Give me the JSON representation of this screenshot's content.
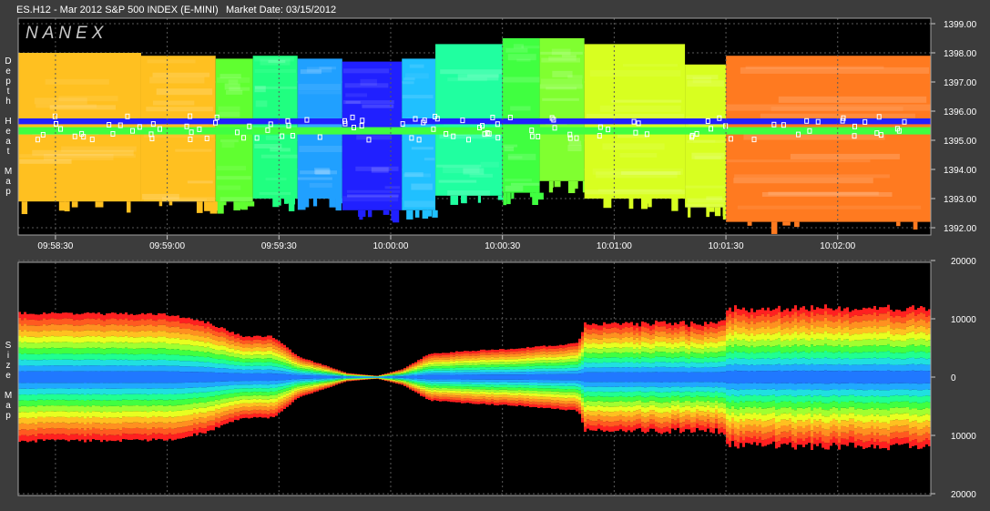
{
  "header": {
    "symbol_title": "ES.H12 - Mar 2012 S&P 500 INDEX (E-MINI)",
    "market_date": "Market Date: 03/15/2012"
  },
  "watermark": "NANEX",
  "colors": {
    "background": "#000000",
    "frame": "#3c3c3c",
    "gridline": "#5a5a5a",
    "heat_scale": [
      "#ff2020",
      "#ff7a20",
      "#ffc020",
      "#d8ff20",
      "#40ff40",
      "#20ffa0",
      "#20c0ff",
      "#2060ff",
      "#2020ff"
    ]
  },
  "chart_data": [
    {
      "type": "heatmap",
      "panel_label": "Depth Heat Map",
      "x_tick_labels": [
        "09:58:30",
        "09:59:00",
        "09:59:30",
        "10:00:00",
        "10:00:30",
        "10:01:00",
        "10:01:30",
        "10:02:00"
      ],
      "y_tick_labels": [
        "1399.00",
        "1398.00",
        "1397.00",
        "1396.00",
        "1395.00",
        "1394.00",
        "1393.00",
        "1392.00"
      ],
      "ylim": [
        1392.0,
        1399.3
      ],
      "grid": true,
      "segments": [
        {
          "t_start": "09:58:20",
          "t_end": "09:58:53",
          "color": "#ffc020",
          "top": 1398.0,
          "bottom": 1392.9
        },
        {
          "t_start": "09:58:53",
          "t_end": "09:59:13",
          "color": "#ffc020",
          "top": 1397.9,
          "bottom": 1392.9
        },
        {
          "t_start": "09:59:13",
          "t_end": "09:59:23",
          "color": "#60ff30",
          "top": 1397.8,
          "bottom": 1392.9
        },
        {
          "t_start": "09:59:23",
          "t_end": "09:59:35",
          "color": "#20ff80",
          "top": 1397.9,
          "bottom": 1393.0
        },
        {
          "t_start": "09:59:35",
          "t_end": "09:59:47",
          "color": "#20a0ff",
          "top": 1397.8,
          "bottom": 1393.0
        },
        {
          "t_start": "09:59:47",
          "t_end": "10:00:03",
          "color": "#2020ff",
          "top": 1397.7,
          "bottom": 1392.6
        },
        {
          "t_start": "10:00:03",
          "t_end": "10:00:12",
          "color": "#20c0ff",
          "top": 1397.8,
          "bottom": 1392.6
        },
        {
          "t_start": "10:00:12",
          "t_end": "10:00:30",
          "color": "#20ffa0",
          "top": 1398.3,
          "bottom": 1393.1
        },
        {
          "t_start": "10:00:30",
          "t_end": "10:00:40",
          "color": "#40ff40",
          "top": 1398.5,
          "bottom": 1393.2
        },
        {
          "t_start": "10:00:40",
          "t_end": "10:00:52",
          "color": "#80ff30",
          "top": 1398.5,
          "bottom": 1393.6
        },
        {
          "t_start": "10:00:52",
          "t_end": "10:01:19",
          "color": "#d8ff20",
          "top": 1398.3,
          "bottom": 1393.0
        },
        {
          "t_start": "10:01:19",
          "t_end": "10:01:30",
          "color": "#d8ff20",
          "top": 1397.6,
          "bottom": 1392.7
        },
        {
          "t_start": "10:01:30",
          "t_end": "10:02:25",
          "color": "#ff7a20",
          "top": 1397.9,
          "bottom": 1392.2
        }
      ],
      "inside_market": [
        {
          "t_start": "09:58:20",
          "t_end": "10:02:25",
          "top": 1395.75,
          "bottom": 1395.55,
          "color": "#2020ff"
        },
        {
          "t_start": "09:58:20",
          "t_end": "10:02:25",
          "top": 1395.45,
          "bottom": 1395.2,
          "color": "#40ff40"
        }
      ]
    },
    {
      "type": "area",
      "panel_label": "Size Map",
      "y_tick_labels": [
        "20000",
        "10000",
        "0",
        "10000",
        "20000"
      ],
      "ylim": [
        -20000,
        20000
      ],
      "grid": true,
      "band_colors": [
        "#ff2020",
        "#ff5a20",
        "#ff9020",
        "#ffc020",
        "#e8ff20",
        "#a0ff30",
        "#40ff40",
        "#20ff90",
        "#20e0e0",
        "#20a8ff",
        "#2078ff"
      ],
      "envelope": {
        "times": [
          "09:58:20",
          "09:58:35",
          "09:59:00",
          "09:59:10",
          "09:59:20",
          "09:59:28",
          "09:59:35",
          "09:59:43",
          "09:59:48",
          "09:59:56",
          "10:00:03",
          "10:00:10",
          "10:00:20",
          "10:00:35",
          "10:00:50",
          "10:00:52",
          "10:01:20",
          "10:01:29",
          "10:01:30",
          "10:02:25"
        ],
        "values": [
          11000,
          11000,
          10800,
          9500,
          7000,
          7000,
          3500,
          1800,
          700,
          200,
          1400,
          4000,
          4500,
          5000,
          5800,
          9500,
          9500,
          9600,
          12000,
          12200
        ]
      }
    }
  ]
}
